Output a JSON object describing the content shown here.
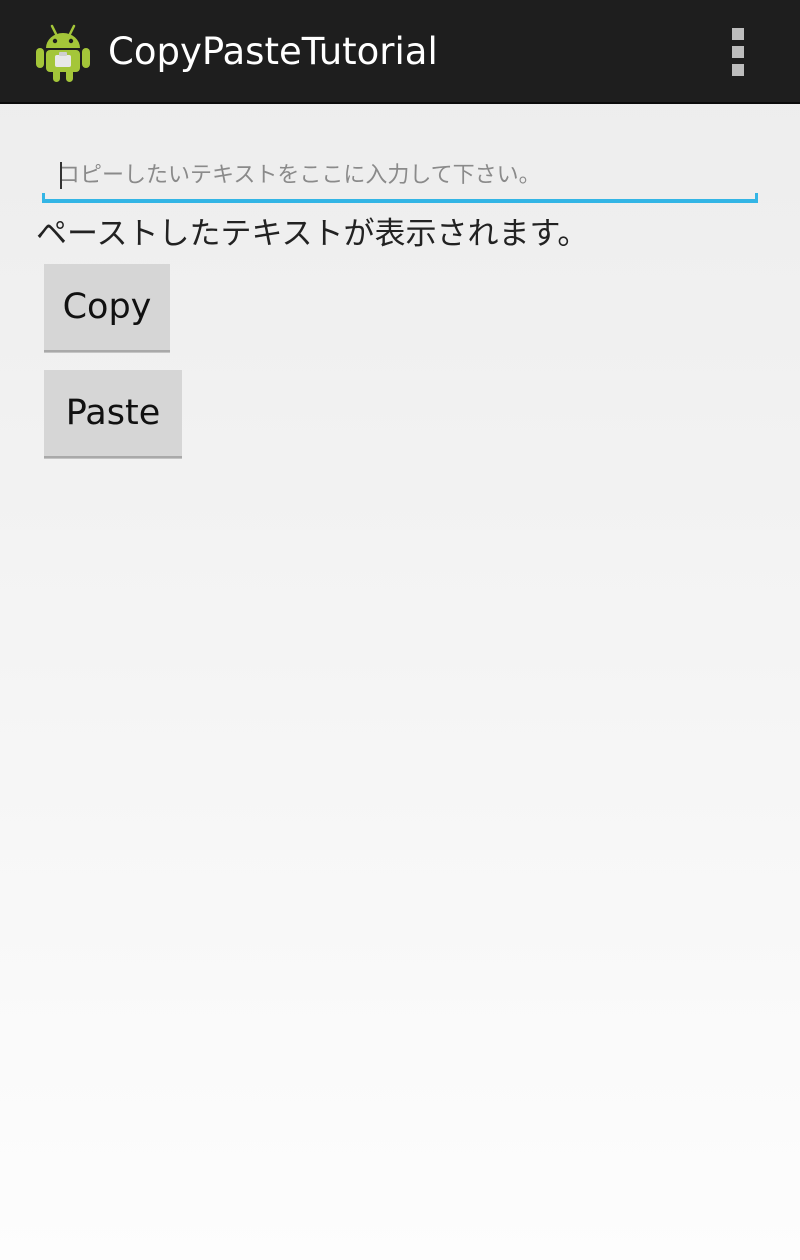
{
  "app": {
    "title": "CopyPasteTutorial",
    "icon": "android-robot-icon",
    "menu_icon": "overflow-menu-icon"
  },
  "form": {
    "input_placeholder": "コピーしたいテキストをここに入力して下さい。",
    "input_value": "",
    "paste_text": "ペーストしたテキストが表示されます。",
    "copy_label": "Copy",
    "paste_label": "Paste"
  },
  "colors": {
    "action_bar": "#1e1e1e",
    "accent": "#33b5e5",
    "button": "#d6d6d6",
    "android_green": "#a4c639"
  }
}
